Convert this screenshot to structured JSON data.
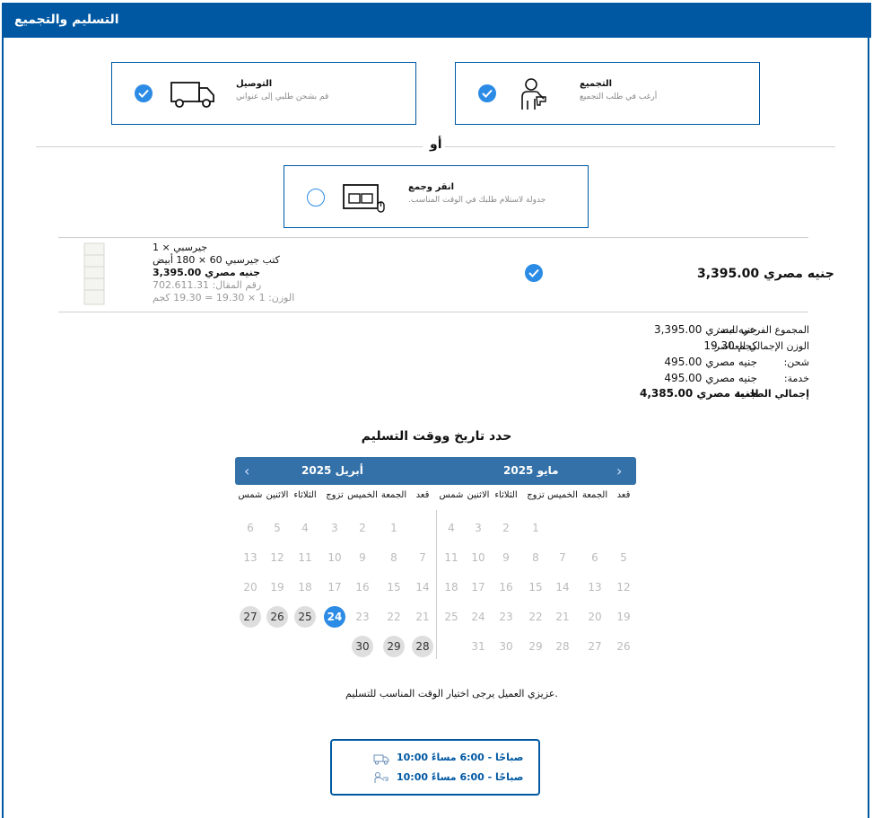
{
  "header": {
    "title": "التسليم والتجميع"
  },
  "options": {
    "assembly": {
      "title": "التجميع",
      "desc": "أرغب في طلب التجميع",
      "selected": true,
      "icon": "assembler-icon"
    },
    "delivery": {
      "title": "التوصيل",
      "desc": "قم بشحن طلبي إلى عنواني",
      "selected": true,
      "icon": "truck-icon"
    },
    "or_label": "أو",
    "click_collect": {
      "title": "انقر وجمع",
      "desc": "جدولة لاستلام طلبك في الوقت المناسب.",
      "selected": false,
      "icon": "click-collect-icon"
    }
  },
  "product": {
    "qty_line": "جيرسبي × 1",
    "name_line": "كتب جيرسبي 60 × 180 أبيض",
    "price_line": "جنيه مصري 3,395.00",
    "article_line": "رقم المقال: 702.611.31",
    "weight_line": "الوزن: 1 × 19.30 = 19.30 كجم",
    "total_price": "جنيه مصري 3,395.00"
  },
  "summary": [
    {
      "label": ":المجموع الفرعي للبند",
      "value": "جنيه مصري 3,395.00"
    },
    {
      "label": ":الوزن الإجمالي للعناصر",
      "value": "كجم 19.30"
    },
    {
      "label": ":شحن",
      "value": "جنيه مصري 495.00"
    },
    {
      "label": ":خدمة",
      "value": "جنيه مصري 495.00"
    },
    {
      "label": ":إجمالي الطلب",
      "value": "جنيه مصري 4,385.00"
    }
  ],
  "calendar": {
    "title": "حدد تاريخ ووقت التسليم",
    "april_label": "أبريل 2025",
    "may_label": "مايو 2025",
    "prev": "‹",
    "next": "›",
    "weekdays": [
      "شمس",
      "الاثنين",
      "الثلاثاء",
      "تزوج",
      "الخميس",
      "الجمعة",
      "قعد"
    ],
    "selected_day": 24
  },
  "note": "عزيزي العميل يرجى اختيار الوقت المناسب للتسليم.",
  "slots": [
    {
      "icon": "truck-icon",
      "text": "صباحًا - 6:00 مساءً 10:00"
    },
    {
      "icon": "assembly-tool-icon",
      "text": "صباحًا - 6:00 مساءً 10:00"
    }
  ]
}
